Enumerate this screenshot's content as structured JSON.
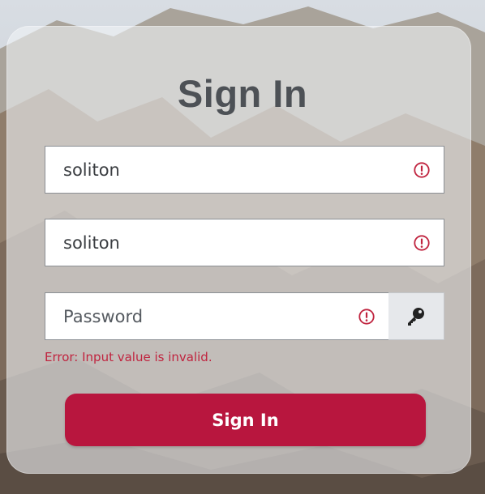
{
  "title": "Sign In",
  "fields": [
    {
      "value": "soliton",
      "state": "error",
      "icon": "error-circle-icon"
    },
    {
      "value": "soliton",
      "state": "error",
      "icon": "error-circle-icon"
    },
    {
      "value": "",
      "placeholder": "Password",
      "state": "error",
      "icon": "error-circle-icon"
    }
  ],
  "password_toggle": {
    "icon": "key-icon"
  },
  "error_message": "Error: Input value is invalid.",
  "submit_label": "Sign In",
  "colors": {
    "error": "#c0243f",
    "primary_button": "#b8163e",
    "title": "#4d5156"
  }
}
